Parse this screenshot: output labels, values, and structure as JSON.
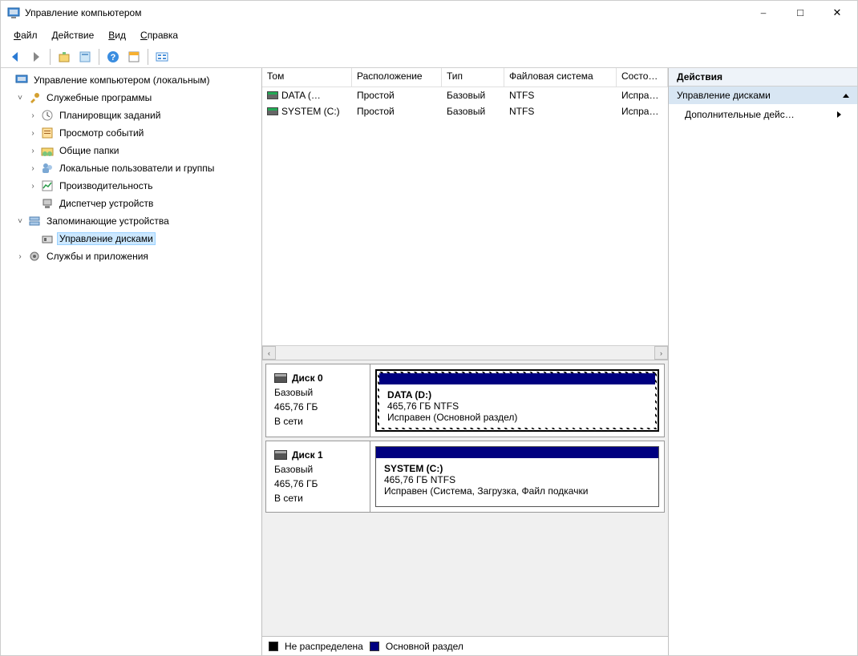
{
  "window": {
    "title": "Управление компьютером"
  },
  "menu": {
    "file": "Файл",
    "action": "Действие",
    "view": "Вид",
    "help": "Справка"
  },
  "tree": {
    "root": "Управление компьютером (локальным)",
    "utilities": "Служебные программы",
    "scheduler": "Планировщик заданий",
    "eventviewer": "Просмотр событий",
    "sharedfolders": "Общие папки",
    "users": "Локальные пользователи и группы",
    "performance": "Производительность",
    "devicemgr": "Диспетчер устройств",
    "storage": "Запоминающие устройства",
    "diskmgmt": "Управление дисками",
    "services": "Службы и приложения"
  },
  "volcols": {
    "volume": "Том",
    "layout": "Расположение",
    "type": "Тип",
    "fs": "Файловая система",
    "status": "Состо…"
  },
  "volumes": [
    {
      "name": "DATA (…",
      "layout": "Простой",
      "type": "Базовый",
      "fs": "NTFS",
      "status": "Испра…"
    },
    {
      "name": "SYSTEM (C:)",
      "layout": "Простой",
      "type": "Базовый",
      "fs": "NTFS",
      "status": "Испра…"
    }
  ],
  "disks": [
    {
      "name": "Диск 0",
      "type": "Базовый",
      "size": "465,76 ГБ",
      "online": "В сети",
      "partition": {
        "name": "DATA  (D:)",
        "info": "465,76 ГБ NTFS",
        "status": "Исправен (Основной раздел)"
      },
      "selected": true
    },
    {
      "name": "Диск 1",
      "type": "Базовый",
      "size": "465,76 ГБ",
      "online": "В сети",
      "partition": {
        "name": "SYSTEM  (C:)",
        "info": "465,76 ГБ NTFS",
        "status": "Исправен (Система, Загрузка, Файл подкачки"
      },
      "selected": false
    }
  ],
  "legend": {
    "unallocated": "Не распределена",
    "primary": "Основной раздел"
  },
  "actions": {
    "header": "Действия",
    "diskmgmt": "Управление дисками",
    "more": "Дополнительные дейс…"
  }
}
